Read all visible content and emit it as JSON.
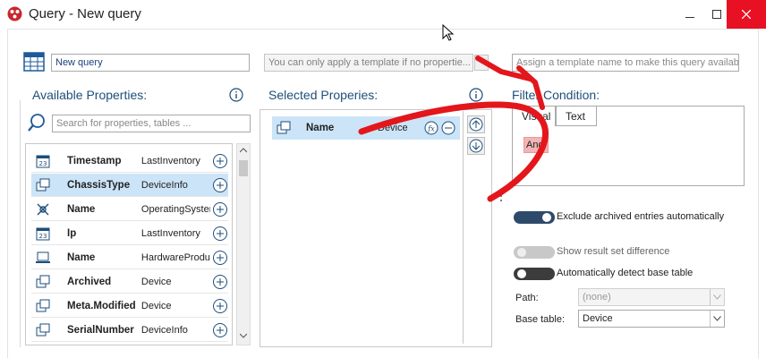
{
  "window": {
    "title": "Query - New query"
  },
  "top": {
    "query_name": "New query",
    "template_placeholder": "You can only apply a template if no propertie...",
    "template_name_placeholder": "Assign a template name to make this query available"
  },
  "available": {
    "title": "Available Properties:",
    "search_placeholder": "Search for properties, tables ...",
    "items": [
      {
        "name": "Timestamp",
        "table": "LastInventory",
        "icon": "calendar-icon"
      },
      {
        "name": "ChassisType",
        "table": "DeviceInfo",
        "icon": "device-info-icon",
        "selected": true
      },
      {
        "name": "Name",
        "table": "OperatingSystem",
        "icon": "os-icon"
      },
      {
        "name": "Ip",
        "table": "LastInventory",
        "icon": "calendar-icon"
      },
      {
        "name": "Name",
        "table": "HardwareProduct",
        "icon": "hardware-icon"
      },
      {
        "name": "Archived",
        "table": "Device",
        "icon": "device-info-icon"
      },
      {
        "name": "Meta.Modified",
        "table": "Device",
        "icon": "device-info-icon"
      },
      {
        "name": "SerialNumber",
        "table": "DeviceInfo",
        "icon": "device-info-icon"
      }
    ]
  },
  "selected": {
    "title": "Selected Properies:",
    "items": [
      {
        "name": "Name",
        "table": "Device"
      }
    ]
  },
  "filter": {
    "title": "Filter Condition:",
    "tabs": [
      "Visual",
      "Text"
    ],
    "active_tab": "Visual",
    "chip": "And"
  },
  "options": {
    "exclude_archived": {
      "label": "Exclude archived entries automatically",
      "on": true
    },
    "show_difference": {
      "label": "Show result set difference",
      "on": false,
      "disabled": true
    },
    "detect_base": {
      "label": "Automatically detect base table",
      "on": false
    }
  },
  "path": {
    "label": "Path:",
    "value": "(none)"
  },
  "base_table": {
    "label": "Base table:",
    "value": "Device"
  },
  "colors": {
    "accent": "#1e4e79",
    "selection": "#cce4f7",
    "toggle_on": "#2e4a6b",
    "annotation_arrow": "#e3161c",
    "close": "#e81123"
  }
}
